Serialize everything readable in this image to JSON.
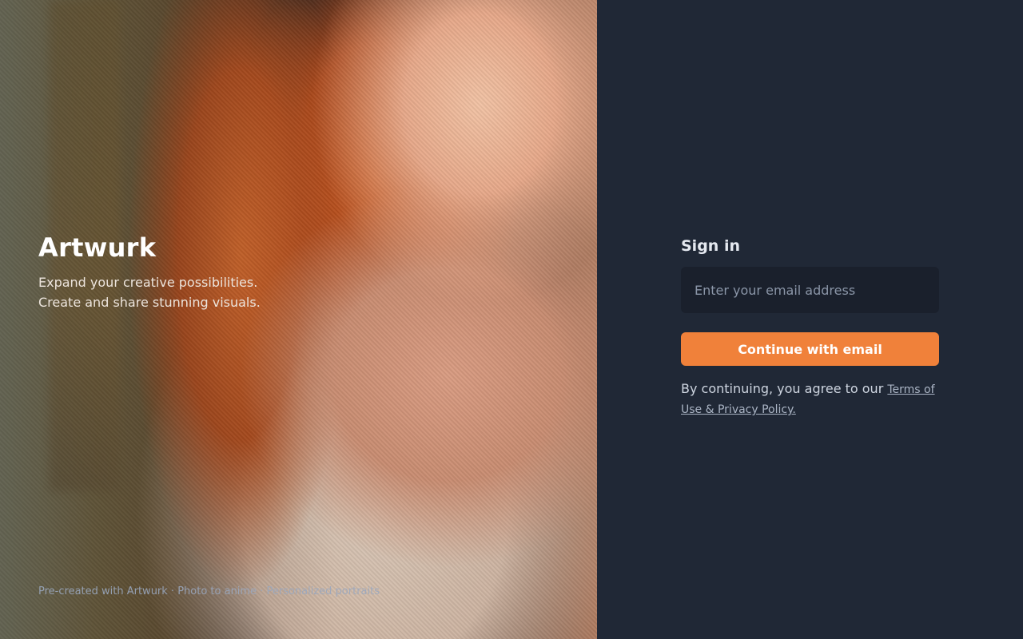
{
  "hero": {
    "brand": "Artwurk",
    "tagline_line1": "Expand your creative possibilities.",
    "tagline_line2": "Create and share stunning visuals.",
    "attribution": "Pre-created with Artwurk · Photo to anime · Personalized portraits"
  },
  "signin": {
    "title": "Sign in",
    "email_placeholder": "Enter your email address",
    "email_value": "",
    "continue_label": "Continue with email",
    "terms_prefix": "By continuing, you agree to our",
    "terms_link": "Terms of Use & Privacy Policy."
  },
  "colors": {
    "panel_bg": "#202836",
    "input_bg": "#1a202c",
    "accent": "#f0813a"
  }
}
